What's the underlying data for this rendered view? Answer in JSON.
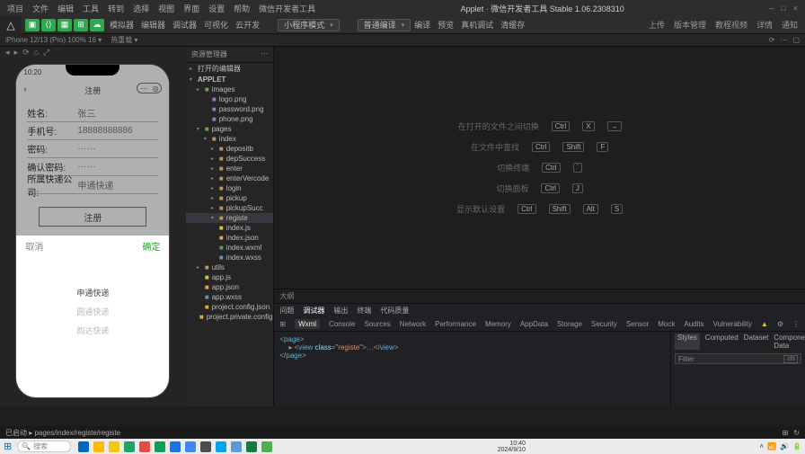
{
  "title": {
    "app": "Applet",
    "tool": "微信开发者工具 Stable 1.06.2308310"
  },
  "menu": [
    "项目",
    "文件",
    "编辑",
    "工具",
    "转到",
    "选择",
    "视图",
    "界面",
    "设置",
    "帮助",
    "微信开发者工具"
  ],
  "winbtns": [
    "–",
    "□",
    "×"
  ],
  "toolrow": {
    "tabs": [
      "模拟器",
      "编辑器",
      "调试器",
      "可视化",
      "云开发"
    ],
    "combo1": "小程序模式",
    "combo2": "普通编译",
    "actions": [
      "编译",
      "预览",
      "真机调试",
      "清缓存"
    ],
    "right": [
      "上传",
      "版本管理",
      "教程视频",
      "详情",
      "通知"
    ]
  },
  "subbar": {
    "device": "iPhone 12/13 (Pro) 100% 16 ▾",
    "trail": "热重载 ▾"
  },
  "simtools": [
    "◂",
    "▸",
    "⟳",
    "⌂",
    "⤢"
  ],
  "phone": {
    "time": "10:20",
    "title": "注册",
    "rows": [
      {
        "lab": "姓名:",
        "val": "张三"
      },
      {
        "lab": "手机号:",
        "val": "18888888886"
      },
      {
        "lab": "密码:",
        "val": "······"
      },
      {
        "lab": "确认密码:",
        "val": "······"
      },
      {
        "lab": "所属快递公司:",
        "val": "申通快递"
      }
    ],
    "button": "注册",
    "picker": {
      "cancel": "取消",
      "confirm": "确定",
      "opts": [
        "申通快递",
        "圆通快递",
        "韵达快递"
      ]
    }
  },
  "filetree": {
    "header": "资源管理器",
    "root": "打开的编辑器",
    "proj": "APPLET",
    "nodes": [
      {
        "t": "▸",
        "c": "i-folderg",
        "n": "images",
        "d": 1
      },
      {
        "t": "",
        "c": "i-img",
        "n": "logo.png",
        "d": 2
      },
      {
        "t": "",
        "c": "i-img",
        "n": "password.png",
        "d": 2
      },
      {
        "t": "",
        "c": "i-img",
        "n": "phone.png",
        "d": 2
      },
      {
        "t": "▾",
        "c": "i-folderg",
        "n": "pages",
        "d": 1
      },
      {
        "t": "▾",
        "c": "i-folder",
        "n": "index",
        "d": 2
      },
      {
        "t": "▸",
        "c": "i-folder",
        "n": "depositb",
        "d": 3
      },
      {
        "t": "▸",
        "c": "i-folder",
        "n": "depSuccess",
        "d": 3
      },
      {
        "t": "▸",
        "c": "i-folder",
        "n": "enter",
        "d": 3
      },
      {
        "t": "▸",
        "c": "i-folder",
        "n": "enterVercode",
        "d": 3
      },
      {
        "t": "▸",
        "c": "i-folder",
        "n": "login",
        "d": 3
      },
      {
        "t": "▸",
        "c": "i-folder",
        "n": "pickup",
        "d": 3
      },
      {
        "t": "▸",
        "c": "i-folder",
        "n": "pickupSucc",
        "d": 3
      },
      {
        "t": "▾",
        "c": "i-folder",
        "n": "registe",
        "d": 3,
        "sel": true
      },
      {
        "t": "",
        "c": "i-js",
        "n": "index.js",
        "d": 3
      },
      {
        "t": "",
        "c": "i-json",
        "n": "index.json",
        "d": 3
      },
      {
        "t": "",
        "c": "i-wxml",
        "n": "index.wxml",
        "d": 3
      },
      {
        "t": "",
        "c": "i-wxss",
        "n": "index.wxss",
        "d": 3
      },
      {
        "t": "▸",
        "c": "i-folder",
        "n": "utils",
        "d": 1
      },
      {
        "t": "",
        "c": "i-js",
        "n": "app.js",
        "d": 1
      },
      {
        "t": "",
        "c": "i-json",
        "n": "app.json",
        "d": 1
      },
      {
        "t": "",
        "c": "i-wxss",
        "n": "app.wxss",
        "d": 1
      },
      {
        "t": "",
        "c": "i-json",
        "n": "project.config.json",
        "d": 1
      },
      {
        "t": "",
        "c": "i-json",
        "n": "project.private.config.js...",
        "d": 1
      }
    ]
  },
  "placeholder": [
    {
      "txt": "在打开的文件之间切换",
      "keys": [
        "Ctrl",
        "X",
        "→"
      ]
    },
    {
      "txt": "在文件中查找",
      "keys": [
        "Ctrl",
        "Shift",
        "F"
      ]
    },
    {
      "txt": "切换终端",
      "keys": [
        "Ctrl",
        "`"
      ]
    },
    {
      "txt": "切换面板",
      "keys": [
        "Ctrl",
        "J"
      ]
    },
    {
      "txt": "显示默认设置",
      "keys": [
        "Ctrl",
        "Shift",
        "Alt",
        "S"
      ]
    }
  ],
  "bottom": [
    "大纲"
  ],
  "devtabs1": [
    "问题",
    "调试器",
    "输出",
    "终端",
    "代码质量"
  ],
  "devtabs2": [
    "⊞",
    "Wxml",
    "Console",
    "Sources",
    "Network",
    "Performance",
    "Memory",
    "AppData",
    "Storage",
    "Security",
    "Sensor",
    "Mock",
    "Audits",
    "Vulnerability"
  ],
  "code": "<page>\n  ▸<view class=\"registe\">…</view>\n</page>",
  "dstabs": [
    "Styles",
    "Computed",
    "Dataset",
    "Component Data"
  ],
  "filter": "Filter",
  "statusbar": {
    "left": "已启动 ▸ pages/index/registe/registe",
    "right": [
      "⊞",
      "↻"
    ]
  },
  "taskbar": {
    "search": "搜索",
    "icons": [
      "#0067c0",
      "#ffb900",
      "#f2c811",
      "#1fa463",
      "#e74c3c",
      "#0f9d58",
      "#1a73e8",
      "#4285f4",
      "#4c4c4c",
      "#00a4ef",
      "#5b9bd5",
      "#107c41",
      "#4caf50"
    ],
    "clock": {
      "t": "10:40",
      "d": "2024/9/10"
    }
  }
}
